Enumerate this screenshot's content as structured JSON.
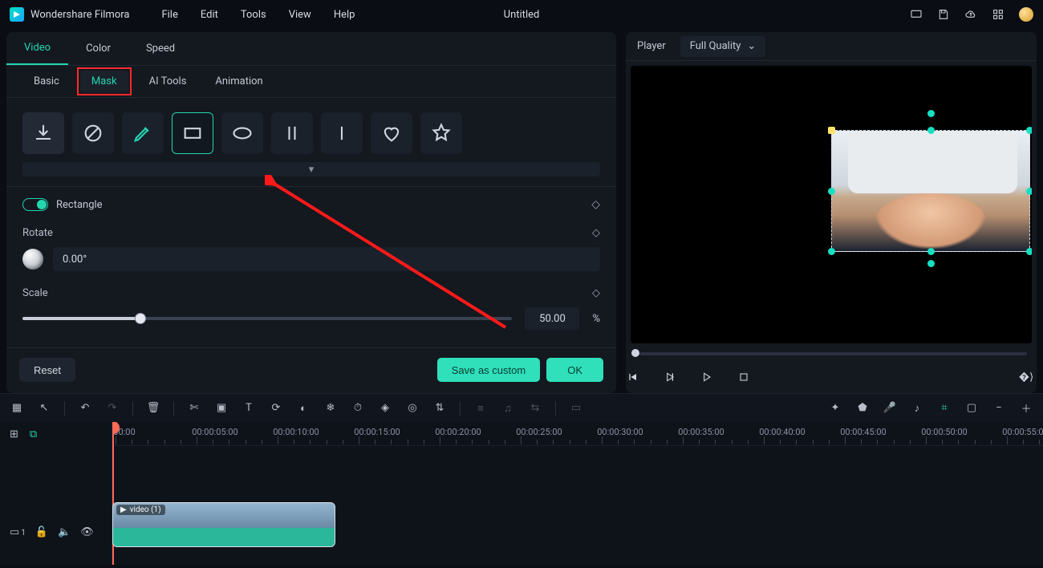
{
  "app": {
    "name": "Wondershare Filmora",
    "doc_title": "Untitled"
  },
  "menu": [
    "File",
    "Edit",
    "Tools",
    "View",
    "Help"
  ],
  "panel_tabs": {
    "items": [
      "Video",
      "Color",
      "Speed"
    ],
    "active": "Video"
  },
  "video_subtabs": {
    "items": [
      "Basic",
      "Mask",
      "AI Tools",
      "Animation"
    ],
    "active": "Mask"
  },
  "mask_shapes": [
    {
      "id": "import",
      "icon": "import"
    },
    {
      "id": "none",
      "icon": "none"
    },
    {
      "id": "pen",
      "icon": "pen"
    },
    {
      "id": "rectangle",
      "icon": "rectangle",
      "selected": true
    },
    {
      "id": "ellipse",
      "icon": "ellipse"
    },
    {
      "id": "twoLines",
      "icon": "two-lines"
    },
    {
      "id": "oneLine",
      "icon": "one-line"
    },
    {
      "id": "heart",
      "icon": "heart"
    },
    {
      "id": "star",
      "icon": "star"
    }
  ],
  "mask_section": {
    "enabled": true,
    "title": "Rectangle",
    "props": {
      "rotate": {
        "label": "Rotate",
        "value": "0.00°"
      },
      "scale": {
        "label": "Scale",
        "value": "50.00",
        "unit": "%",
        "percent": 24
      }
    }
  },
  "panel_footer": {
    "reset": "Reset",
    "save_custom": "Save as custom",
    "ok": "OK"
  },
  "player": {
    "label": "Player",
    "quality": "Full Quality",
    "transport_icons": [
      "prev-frame",
      "play-pause",
      "play",
      "stop"
    ]
  },
  "timeline_toolbar_left": [
    "layout",
    "pointer",
    "sep",
    "undo",
    "redo",
    "sep",
    "delete",
    "sep",
    "cut",
    "crop",
    "text",
    "speed",
    "color",
    "freeze",
    "keyframe",
    "record",
    "effects",
    "sep",
    "audio-adjust",
    "audio-mix",
    "audio-stretch",
    "sep",
    "render"
  ],
  "timeline_toolbar_right": [
    "ai",
    "marker",
    "voiceover",
    "music",
    "autoframe",
    "thumbnail",
    "zoom-out",
    "zoom-slider",
    "zoom-in"
  ],
  "ruler": {
    "labels": [
      "00:00",
      "00:00:05:00",
      "00:00:10:00",
      "00:00:15:00",
      "00:00:20:00",
      "00:00:25:00",
      "00:00:30:00",
      "00:00:35:00",
      "00:00:40:00",
      "00:00:45:00",
      "00:00:50:00",
      "00:00:55:00"
    ],
    "spacing_px": 101
  },
  "track_controls": {
    "track_label": "1"
  },
  "clip": {
    "label": "video (1)"
  }
}
